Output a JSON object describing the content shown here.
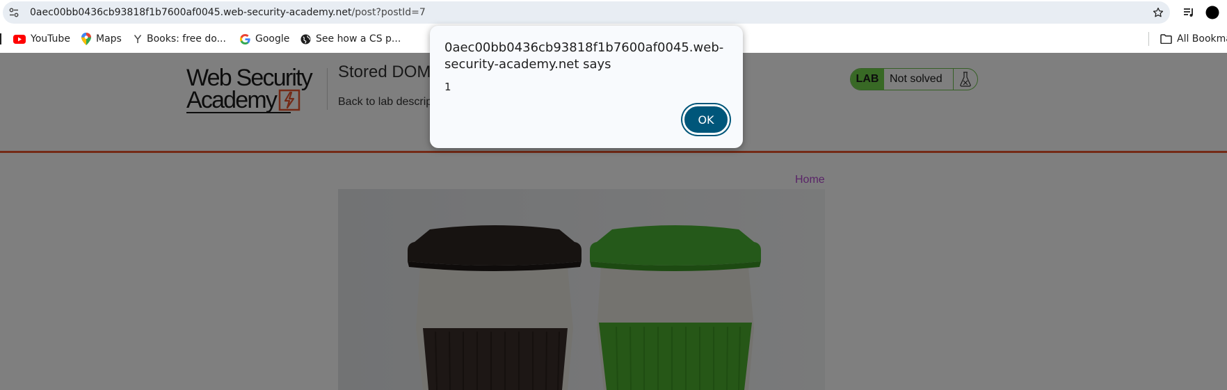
{
  "browser": {
    "url_host": "0aec00bb0436cb93818f1b7600af0045.web-security-academy.net",
    "url_path": "/post?postId=7",
    "icons": [
      "tune-icon",
      "star-icon",
      "media-queue-icon",
      "profile-icon"
    ],
    "bookmarks": [
      {
        "label": "YouTube",
        "icon": "youtube-icon"
      },
      {
        "label": "Maps",
        "icon": "maps-icon"
      },
      {
        "label": "Books: free do...",
        "icon": "ycombinator-icon"
      },
      {
        "label": "Google",
        "icon": "google-icon"
      },
      {
        "label": "See how a CS p...",
        "icon": "globe-icon"
      },
      {
        "label": "All Bookma",
        "icon": "folder-icon"
      }
    ]
  },
  "header": {
    "logo_line1": "Web Security",
    "logo_line2": "Academy",
    "lab_title": "Stored DOM",
    "back_link": "Back to lab descrip",
    "lab_tag": "LAB",
    "lab_status": "Not solved",
    "accent_color": "#e8542c",
    "status_color": "#70d24b"
  },
  "nav": {
    "home": "Home"
  },
  "dialog": {
    "title": "0aec00bb0436cb93818f1b7600af0045.web-security-academy.net says",
    "message": "1",
    "ok_label": "OK",
    "button_color": "#00567a"
  }
}
